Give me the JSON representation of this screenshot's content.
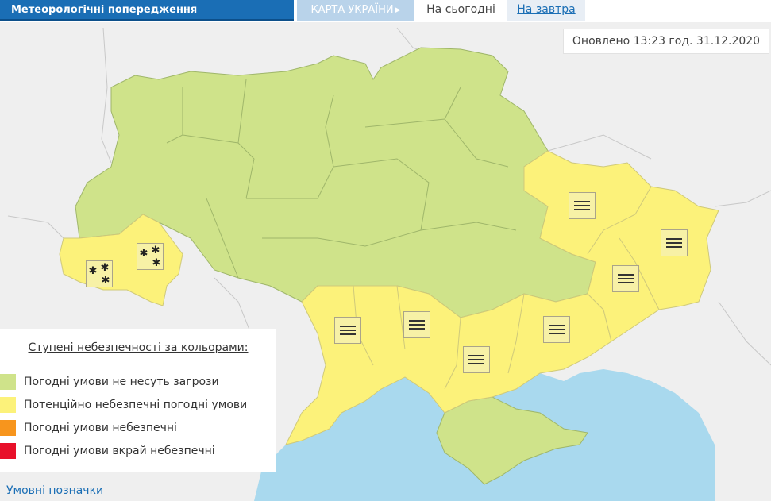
{
  "header": {
    "title": "Метеорологічні попередження",
    "map_tab": "КАРТА УКРАЇНИ",
    "today_tab": "На сьогодні",
    "tomorrow_tab": "На завтра"
  },
  "updated": "Оновлено 13:23 год. 31.12.2020",
  "legend": {
    "title": "Ступені небезпечності за кольорами:",
    "items": [
      {
        "label": "Погодні умови не несуть загрози",
        "color": "#cfe38a"
      },
      {
        "label": "Потенційно небезпечні погодні умови",
        "color": "#fcf27a"
      },
      {
        "label": "Погодні умови небезпечні",
        "color": "#f7951d"
      },
      {
        "label": "Погодні умови вкрай небезпечні",
        "color": "#e8102a"
      }
    ]
  },
  "symbols_link": "Умовні позначки",
  "map_colors": {
    "land_outside": "#efefef",
    "sea": "#a9d9ee",
    "level_green": "#cfe38a",
    "level_yellow": "#fcf27a",
    "border": "#9fb66a"
  },
  "warning_markers": [
    {
      "region": "Закарпатська",
      "icon": "snow-icon"
    },
    {
      "region": "Івано-Франківська",
      "icon": "snow-icon"
    },
    {
      "region": "Харківська",
      "icon": "fog-icon"
    },
    {
      "region": "Луганська",
      "icon": "fog-icon"
    },
    {
      "region": "Донецька",
      "icon": "fog-icon"
    },
    {
      "region": "Одеська",
      "icon": "fog-icon"
    },
    {
      "region": "Миколаївська",
      "icon": "fog-icon"
    },
    {
      "region": "Херсонська",
      "icon": "fog-icon"
    },
    {
      "region": "Запорізька",
      "icon": "fog-icon"
    }
  ]
}
